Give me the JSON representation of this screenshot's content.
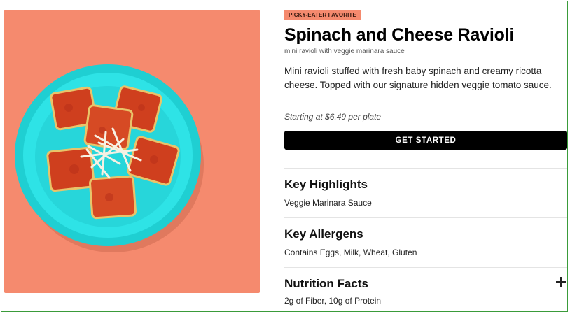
{
  "product": {
    "badge": "PICKY-EATER FAVORITE",
    "title": "Spinach and Cheese Ravioli",
    "subtitle": "mini ravioli with veggie marinara sauce",
    "description": "Mini ravioli stuffed with fresh baby spinach and creamy ricotta cheese. Topped with our signature hidden veggie tomato sauce.",
    "price_text": "Starting at $6.49 per plate",
    "cta_label": "GET STARTED",
    "image_icon": "ravioli-plate-photo"
  },
  "sections": [
    {
      "title": "Key Highlights",
      "body": "Veggie Marinara Sauce"
    },
    {
      "title": "Key Allergens",
      "body": "Contains Eggs, Milk, Wheat, Gluten"
    },
    {
      "title": "Nutrition Facts",
      "body": "2g of Fiber, 10g of Protein",
      "expand_icon": "plus-icon"
    }
  ],
  "colors": {
    "hero_background": "#f58a6e",
    "plate": "#22d8dc",
    "sauce": "#d2401f",
    "cta_background": "#000000",
    "frame_border": "#3a9b3a"
  }
}
